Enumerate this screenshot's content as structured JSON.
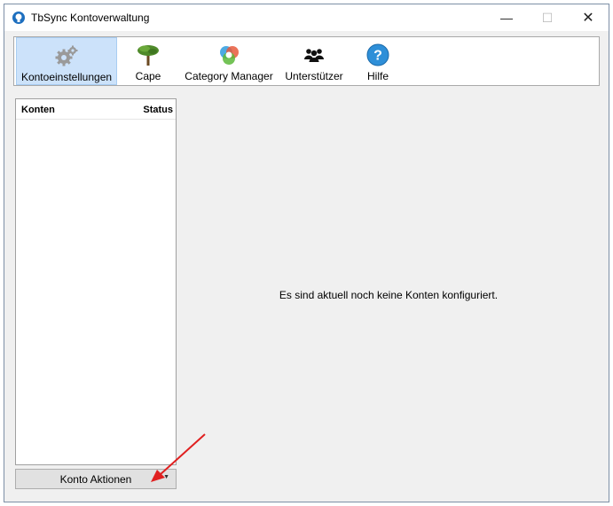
{
  "window": {
    "title": "TbSync Kontoverwaltung",
    "controls": {
      "minimize": "—",
      "maximize": "☐",
      "close": "✕"
    }
  },
  "toolbar": {
    "items": [
      {
        "label": "Kontoeinstellungen",
        "icon": "gears-icon",
        "selected": true
      },
      {
        "label": "Cape",
        "icon": "tree-icon",
        "selected": false
      },
      {
        "label": "Category Manager",
        "icon": "category-circles-icon",
        "selected": false
      },
      {
        "label": "Unterstützer",
        "icon": "people-icon",
        "selected": false
      },
      {
        "label": "Hilfe",
        "icon": "help-icon",
        "selected": false
      }
    ]
  },
  "accounts": {
    "columns": {
      "name": "Konten",
      "status": "Status"
    },
    "rows": []
  },
  "actions": {
    "label": "Konto Aktionen",
    "dropdown_glyph": "▼"
  },
  "main": {
    "empty_message": "Es sind aktuell noch keine Konten konfiguriert."
  },
  "colors": {
    "selected_bg": "#cce2fa",
    "window_bg": "#f0f0f0",
    "annotation_arrow": "#e02020"
  }
}
